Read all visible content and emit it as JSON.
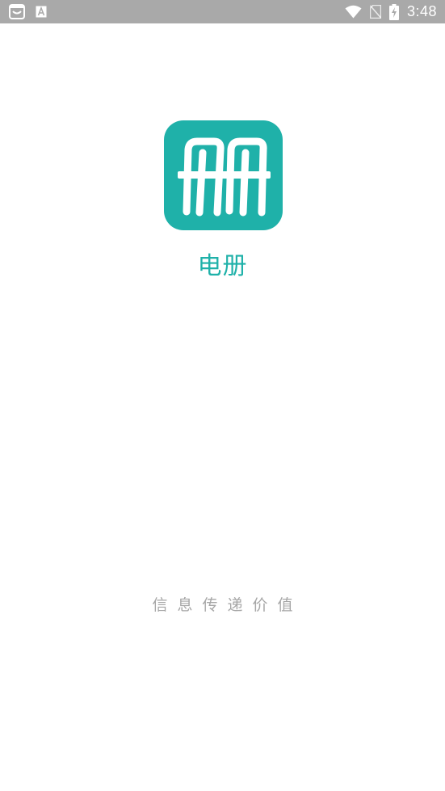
{
  "status_bar": {
    "time": "3:48",
    "left_icons": [
      "smiley-notification-icon",
      "a-notification-icon"
    ],
    "right_icons": [
      "wifi-icon",
      "no-sim-icon",
      "battery-charging-icon"
    ]
  },
  "splash": {
    "app_name": "电册",
    "slogan": "信息传递价值",
    "logo_icon": "app-logo-icon"
  },
  "colors": {
    "brand": "#1fb1a9",
    "status_bar": "#a9a9a9",
    "slogan": "#a6a6a6",
    "background": "#ffffff"
  }
}
